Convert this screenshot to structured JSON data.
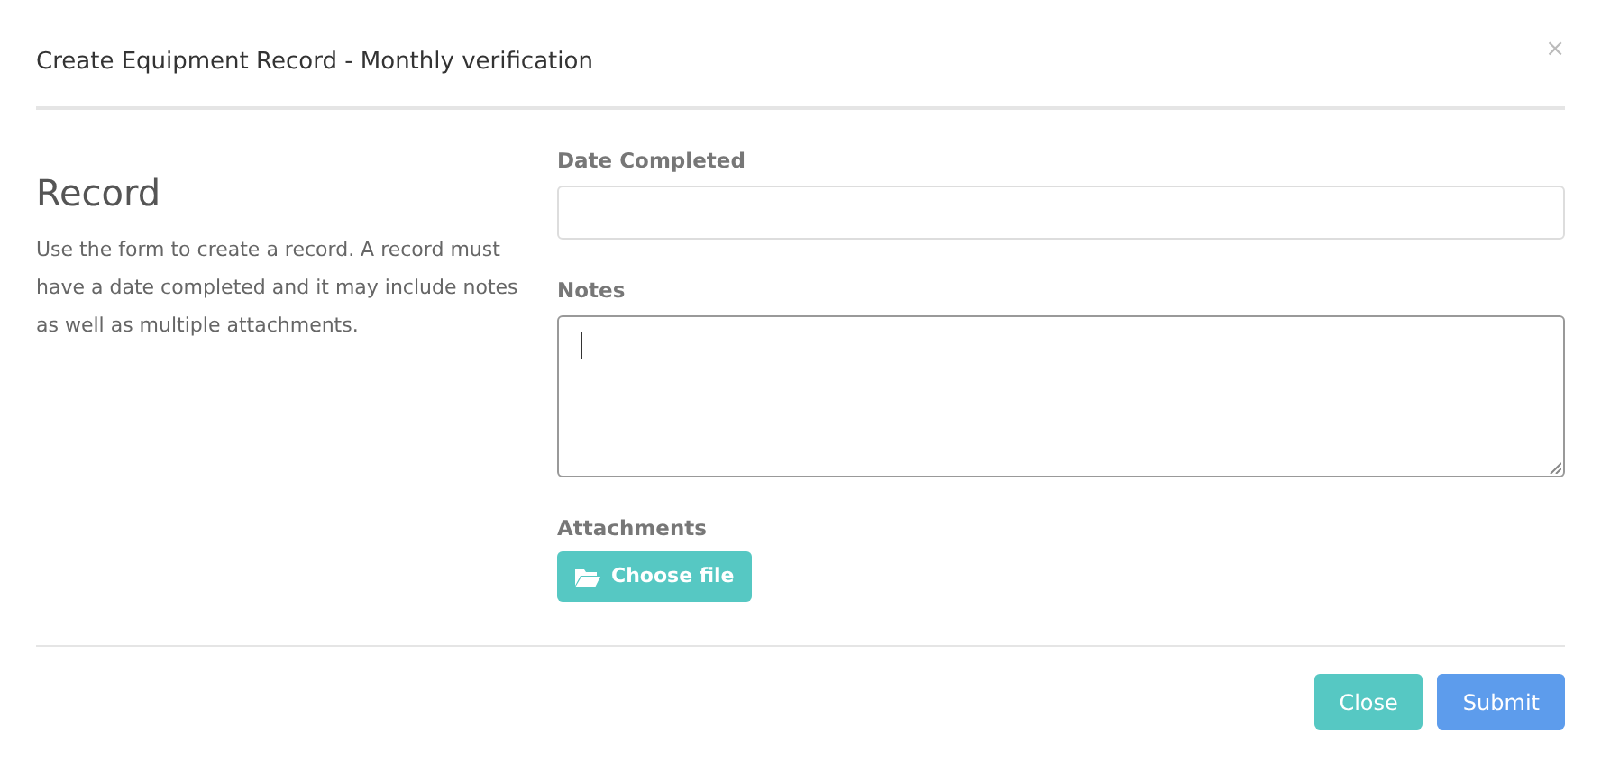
{
  "dialog": {
    "title": "Create Equipment Record - Monthly verification",
    "close_glyph": "×"
  },
  "intro": {
    "heading": "Record",
    "text": "Use the form to create a record. A record must have a date completed and it may include notes as well as multiple attachments."
  },
  "fields": [
    {
      "kind": "input",
      "label": "Date Completed",
      "focused": false
    },
    {
      "kind": "textarea",
      "label": "Notes",
      "focused": true
    },
    {
      "kind": "file",
      "label": "Attachments",
      "button": "Choose file"
    }
  ],
  "buttons": [
    {
      "label": "Close",
      "kind": "secondary"
    },
    {
      "label": "Submit",
      "kind": "primary"
    }
  ]
}
